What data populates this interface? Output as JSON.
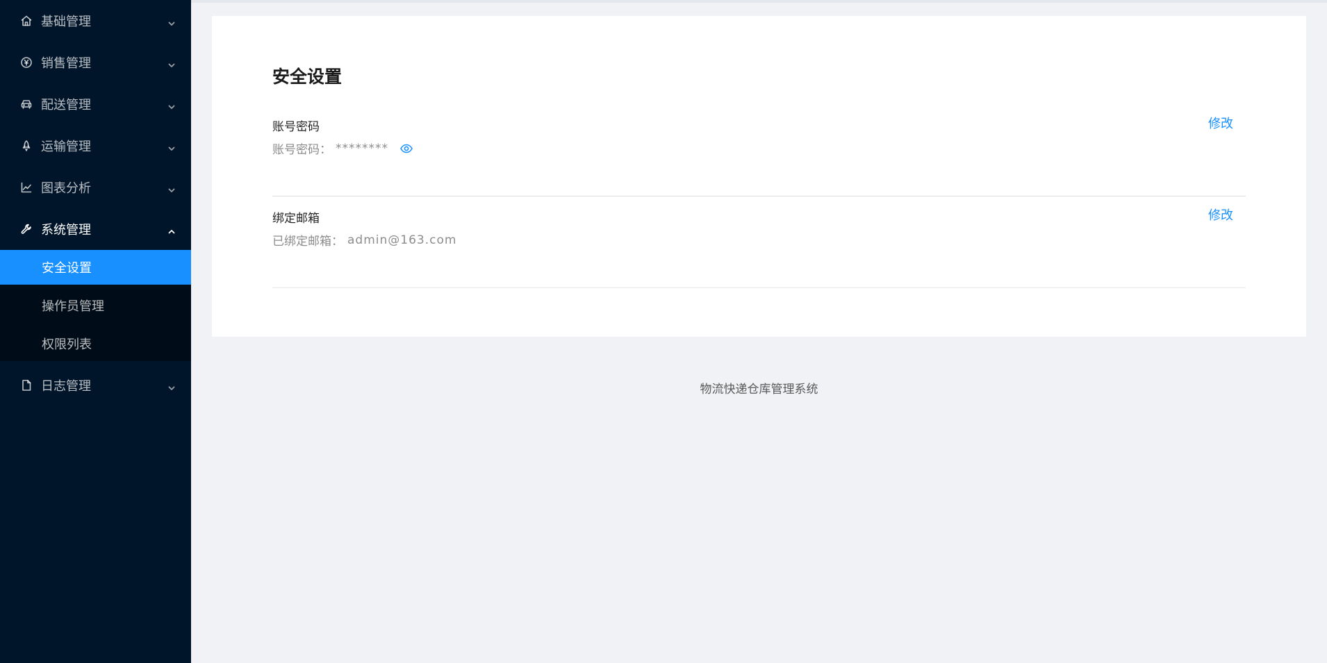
{
  "sidebar": {
    "items": [
      {
        "label": "基础管理",
        "icon": "home-icon"
      },
      {
        "label": "销售管理",
        "icon": "yen-icon"
      },
      {
        "label": "配送管理",
        "icon": "car-icon"
      },
      {
        "label": "运输管理",
        "icon": "rocket-icon"
      },
      {
        "label": "图表分析",
        "icon": "line-chart-icon"
      },
      {
        "label": "系统管理",
        "icon": "tool-icon"
      },
      {
        "label": "日志管理",
        "icon": "file-icon"
      }
    ],
    "submenu": [
      {
        "label": "安全设置"
      },
      {
        "label": "操作员管理"
      },
      {
        "label": "权限列表"
      }
    ],
    "active_item": "安全设置",
    "expanded_item": "系统管理"
  },
  "main": {
    "title": "安全设置",
    "rows": [
      {
        "title": "账号密码",
        "desc_label": "账号密码：",
        "desc_value": "********",
        "action": "修改"
      },
      {
        "title": "绑定邮箱",
        "desc_label": "已绑定邮箱：",
        "desc_value": "admin@163.com",
        "action": "修改"
      }
    ]
  },
  "footer": {
    "text": "物流快递仓库管理系统"
  },
  "colors": {
    "sidebar_bg": "#001529",
    "submenu_bg": "#000c17",
    "accent": "#1890ff",
    "page_bg": "#f0f2f5"
  }
}
